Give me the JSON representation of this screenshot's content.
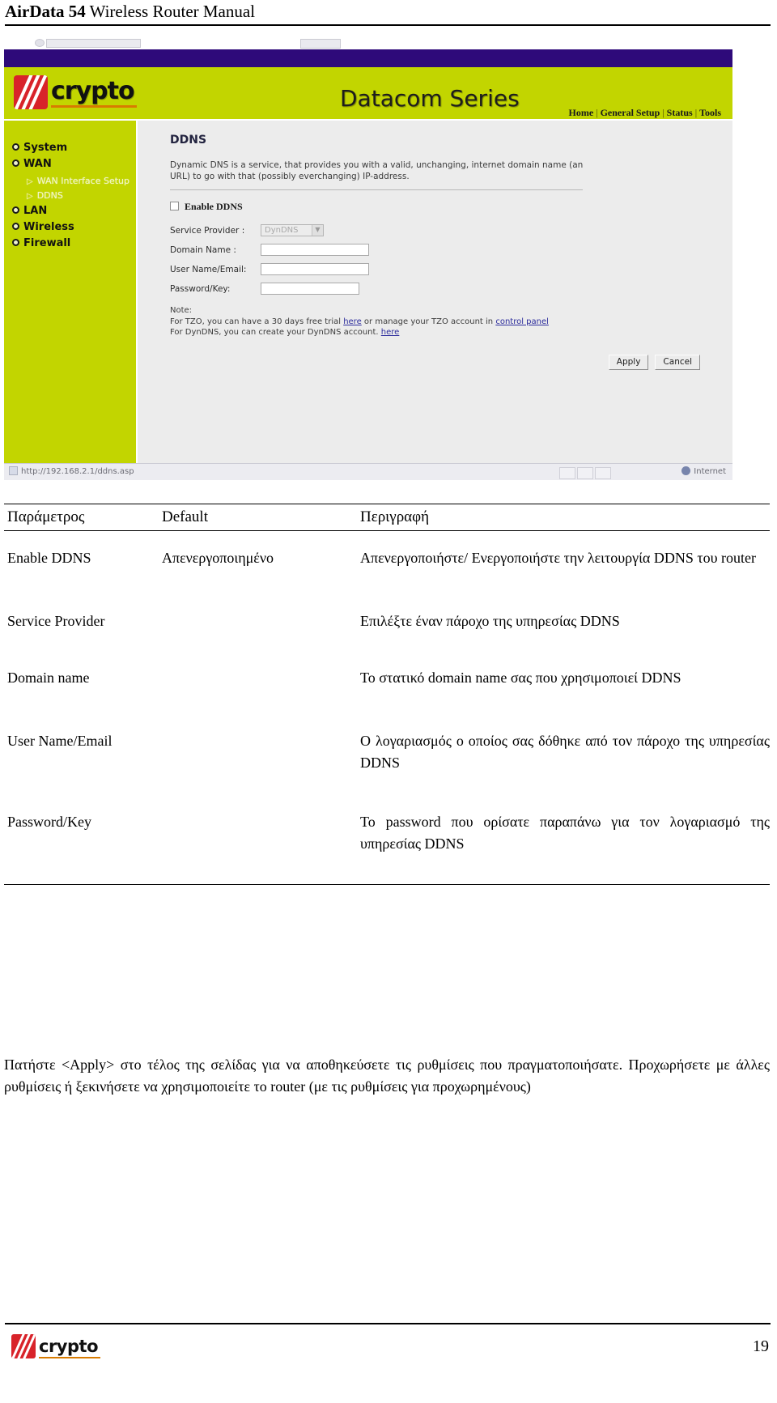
{
  "document": {
    "header_title_bold": "AirData 54",
    "header_title_rest": " Wireless Router Manual",
    "page_number": "19"
  },
  "screenshot": {
    "brand": {
      "logo_word": "crypto",
      "series_title": "Datacom Series"
    },
    "topnav": {
      "items": [
        "Home",
        "General Setup",
        "Status",
        "Tools"
      ],
      "separator": "|"
    },
    "sidebar": {
      "items": [
        {
          "label": "System",
          "icon": "radio-bullet-icon"
        },
        {
          "label": "WAN",
          "icon": "radio-bullet-icon"
        },
        {
          "label": "LAN",
          "icon": "radio-bullet-icon"
        },
        {
          "label": "Wireless",
          "icon": "radio-bullet-icon"
        },
        {
          "label": "Firewall",
          "icon": "radio-bullet-icon"
        }
      ],
      "subitems": [
        {
          "label": "WAN Interface Setup",
          "icon": "triangle-right-icon"
        },
        {
          "label": "DDNS",
          "icon": "triangle-right-icon"
        }
      ]
    },
    "panel": {
      "title": "DDNS",
      "description": "Dynamic DNS is a service, that provides you with a valid, unchanging, internet domain name (an URL) to go with that (possibly everchanging) IP-address.",
      "enable_label": "Enable DDNS",
      "enable_checked": false,
      "fields": [
        {
          "label": "Service Provider :",
          "type": "select",
          "value": "DynDNS",
          "disabled": true
        },
        {
          "label": "Domain Name :",
          "type": "text",
          "value": ""
        },
        {
          "label": "User Name/Email:",
          "type": "text",
          "value": ""
        },
        {
          "label": "Password/Key:",
          "type": "text",
          "value": ""
        }
      ],
      "note": {
        "heading": "Note:",
        "line1_a": "For TZO, you can have a 30 days free trial ",
        "line1_link1": "here",
        "line1_b": " or manage your TZO account in ",
        "line1_link2": "control panel",
        "line2_a": "For DynDNS, you can create your DynDNS account. ",
        "line2_link1": "here"
      },
      "buttons": {
        "apply": "Apply",
        "cancel": "Cancel"
      }
    },
    "statusbar": {
      "url": "http://192.168.2.1/ddns.asp",
      "zone": "Internet"
    }
  },
  "table": {
    "headers": [
      "Παράμετρος",
      "Default",
      "Περιγραφή"
    ],
    "rows": [
      {
        "name": "Enable DDNS",
        "default": "Απενεργοποιημένο",
        "description": "Απενεργοποιήστε/ Ενεργοποιήστε την λειτουργία DDNS του router"
      },
      {
        "name": "Service Provider",
        "default": "",
        "description": "Επιλέξτε έναν πάροχο της υπηρεσίας DDNS"
      },
      {
        "name": "Domain name",
        "default": "",
        "description": "Το στατικό domain name σας που χρησιμοποιεί DDNS"
      },
      {
        "name": "User Name/Email",
        "default": "",
        "description": "Ο λογαριασμός ο οποίος σας δόθηκε από τον πάροχο της υπηρεσίας DDNS"
      },
      {
        "name": "Password/Key",
        "default": "",
        "description": "Το password που ορίσατε παραπάνω για τον λογαριασμό της υπηρεσίας DDNS"
      }
    ]
  },
  "footnote": {
    "text": "Πατήστε <Apply> στο τέλος της σελίδας για να αποθηκεύσετε τις ρυθμίσεις που πραγματοποιήσατε. Προχωρήσετε με άλλες ρυθμίσεις ή ξεκινήσετε να χρησιμοποιείτε το router (με τις ρυθμίσεις για προχωρημένους)"
  },
  "colors": {
    "brand_green": "#c2d500",
    "titlebar_purple": "#2e0a7a",
    "logo_red": "#d8232a",
    "logo_orange": "#d87b00",
    "panel_bg": "#ececec"
  }
}
